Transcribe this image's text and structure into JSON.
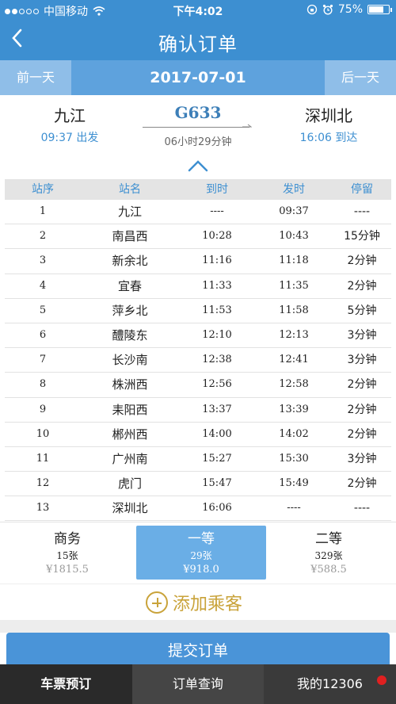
{
  "status_bar": {
    "carrier": "中国移动",
    "time": "下午4:02",
    "battery": "75%",
    "battery_level": 0.75
  },
  "nav": {
    "back_icon": "chevron-left-icon",
    "title": "确认订单"
  },
  "date_bar": {
    "prev_label": "前一天",
    "date": "2017-07-01",
    "next_label": "后一天"
  },
  "train": {
    "from_station": "九江",
    "from_time": "09:37 出发",
    "number": "G633",
    "duration": "06小时29分钟",
    "to_station": "深圳北",
    "to_time": "16:06 到达"
  },
  "stops": {
    "headers": [
      "站序",
      "站名",
      "到时",
      "发时",
      "停留"
    ],
    "rows": [
      [
        "1",
        "九江",
        "----",
        "09:37",
        "----"
      ],
      [
        "2",
        "南昌西",
        "10:28",
        "10:43",
        "15分钟"
      ],
      [
        "3",
        "新余北",
        "11:16",
        "11:18",
        "2分钟"
      ],
      [
        "4",
        "宜春",
        "11:33",
        "11:35",
        "2分钟"
      ],
      [
        "5",
        "萍乡北",
        "11:53",
        "11:58",
        "5分钟"
      ],
      [
        "6",
        "醴陵东",
        "12:10",
        "12:13",
        "3分钟"
      ],
      [
        "7",
        "长沙南",
        "12:38",
        "12:41",
        "3分钟"
      ],
      [
        "8",
        "株洲西",
        "12:56",
        "12:58",
        "2分钟"
      ],
      [
        "9",
        "耒阳西",
        "13:37",
        "13:39",
        "2分钟"
      ],
      [
        "10",
        "郴州西",
        "14:00",
        "14:02",
        "2分钟"
      ],
      [
        "11",
        "广州南",
        "15:27",
        "15:30",
        "3分钟"
      ],
      [
        "12",
        "虎门",
        "15:47",
        "15:49",
        "2分钟"
      ],
      [
        "13",
        "深圳北",
        "16:06",
        "----",
        "----"
      ]
    ]
  },
  "seats": [
    {
      "name": "商务",
      "count": "15张",
      "price": "¥1815.5"
    },
    {
      "name": "一等",
      "count": "29张",
      "price": "¥918.0"
    },
    {
      "name": "二等",
      "count": "329张",
      "price": "¥588.5"
    }
  ],
  "add_passenger_label": "添加乘客",
  "submit_label": "提交订单",
  "tabs": [
    "车票预订",
    "订单查询",
    "我的12306"
  ],
  "colors": {
    "primary": "#3d8fd1",
    "accent_gold": "#c9a33a",
    "selected_seat": "#6aaee6",
    "badge": "#e02020"
  }
}
